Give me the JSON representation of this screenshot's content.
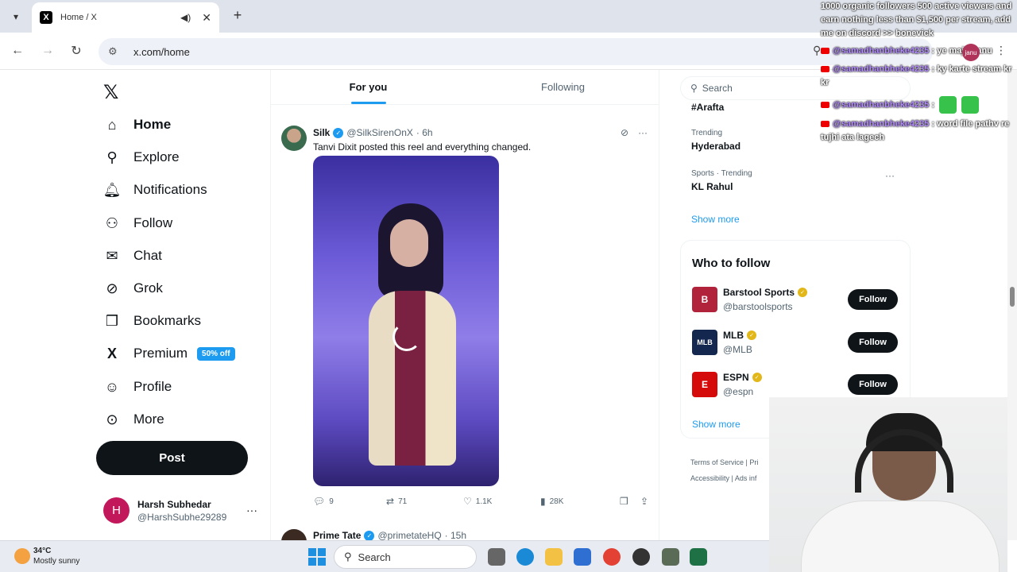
{
  "browser": {
    "tab_title": "Home / X",
    "tab_favicon": "X",
    "url": "x.com/home",
    "profile_initial": "janu"
  },
  "nav": {
    "items": [
      {
        "label": "Home",
        "icon": "home-icon",
        "glyph": "⌂"
      },
      {
        "label": "Explore",
        "icon": "search-icon",
        "glyph": "⚲"
      },
      {
        "label": "Notifications",
        "icon": "bell-icon",
        "glyph": "♫"
      },
      {
        "label": "Follow",
        "icon": "person-plus-icon",
        "glyph": "⚇"
      },
      {
        "label": "Chat",
        "icon": "mail-icon",
        "glyph": "✉"
      },
      {
        "label": "Grok",
        "icon": "grok-icon",
        "glyph": "⊘"
      },
      {
        "label": "Bookmarks",
        "icon": "bookmark-icon",
        "glyph": "❒"
      },
      {
        "label": "Premium",
        "icon": "x-premium-icon",
        "glyph": "X"
      },
      {
        "label": "Profile",
        "icon": "profile-icon",
        "glyph": "☺"
      },
      {
        "label": "More",
        "icon": "more-circle-icon",
        "glyph": "⊙"
      }
    ],
    "premium_badge": "50% off",
    "post_button": "Post",
    "account": {
      "name": "Harsh Subhedar",
      "handle": "@HarshSubhe29289",
      "initial": "H"
    }
  },
  "feed": {
    "tabs": [
      "For you",
      "Following"
    ],
    "tweet": {
      "name": "Silk",
      "handle": "@SilkSirenOnX",
      "time": "· 6h",
      "text": "Tanvi Dixit posted this reel and everything changed.",
      "replies": "9",
      "reposts": "71",
      "likes": "1.1K",
      "views": "28K"
    },
    "tweet2": {
      "name": "Prime Tate",
      "handle": "@primetateHQ",
      "time": "· 15h"
    }
  },
  "sidebar": {
    "search_placeholder": "Search",
    "trend_top": "#Arafta",
    "trends": [
      {
        "meta": "Trending",
        "name": "Hyderabad"
      },
      {
        "meta": "Sports · Trending",
        "name": "KL Rahul"
      }
    ],
    "show_more": "Show more",
    "who_to_follow": "Who to follow",
    "follow_accounts": [
      {
        "name": "Barstool Sports",
        "handle": "@barstoolsports",
        "logo": "B",
        "color": "#b0233a"
      },
      {
        "name": "MLB",
        "handle": "@MLB",
        "logo": "MLB",
        "color": "#13274f"
      },
      {
        "name": "ESPN",
        "handle": "@espn",
        "logo": "E",
        "color": "#d50a0a"
      }
    ],
    "follow_label": "Follow",
    "show_more_2": "Show more",
    "footer": [
      "Terms of Service |  Pri",
      "Accessibility  |  Ads inf"
    ]
  },
  "stream_overlay": {
    "promo": "1000 organic followers 500 active viewers and earn nothing less than $1,500 per stream, add me on discord >> bonevick",
    "chat": [
      {
        "user": "@samadhanbheke4235",
        "message": ": ye majhi janu"
      },
      {
        "user": "@samadhanbheke4235",
        "message": ": ky karte stream kr kr"
      },
      {
        "user": "@samadhanbheke4235",
        "message": ":"
      },
      {
        "user": "@samadhanbheke4235",
        "message": ": word file pathv re tujhi ata lagech"
      }
    ]
  },
  "taskbar": {
    "temperature": "34°C",
    "weather": "Mostly sunny",
    "search": "Search"
  }
}
